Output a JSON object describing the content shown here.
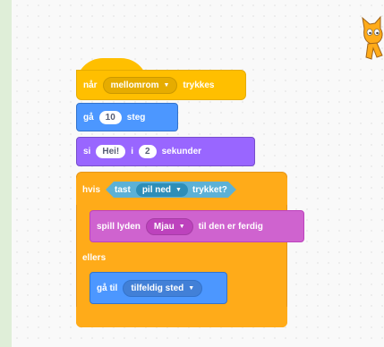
{
  "event_block": {
    "label": "når",
    "key": "mellomrom",
    "suffix": "trykkes"
  },
  "move_block": {
    "label": "gå",
    "value": "10",
    "suffix": "steg"
  },
  "say_block": {
    "label": "si",
    "message": "Hei!",
    "connector": "i",
    "seconds": "2",
    "suffix": "sekunder"
  },
  "if_block": {
    "label": "hvis",
    "condition": {
      "label": "tast",
      "key": "pil ned",
      "suffix": "trykket?"
    },
    "else_label": "ellers"
  },
  "sound_block": {
    "label": "spill lyden",
    "sound": "Mjau",
    "suffix": "til den er ferdig"
  },
  "goto_block": {
    "label": "gå til",
    "target": "tilfeldig sted"
  },
  "colors": {
    "events": "#ffbf00",
    "motion": "#4c97ff",
    "looks": "#9966ff",
    "control": "#ffab19",
    "sound": "#cf63cf",
    "sensing": "#5cb1d6"
  },
  "icons": {
    "sprite": "cat-sprite-icon",
    "dropdown": "caret-down-icon"
  }
}
